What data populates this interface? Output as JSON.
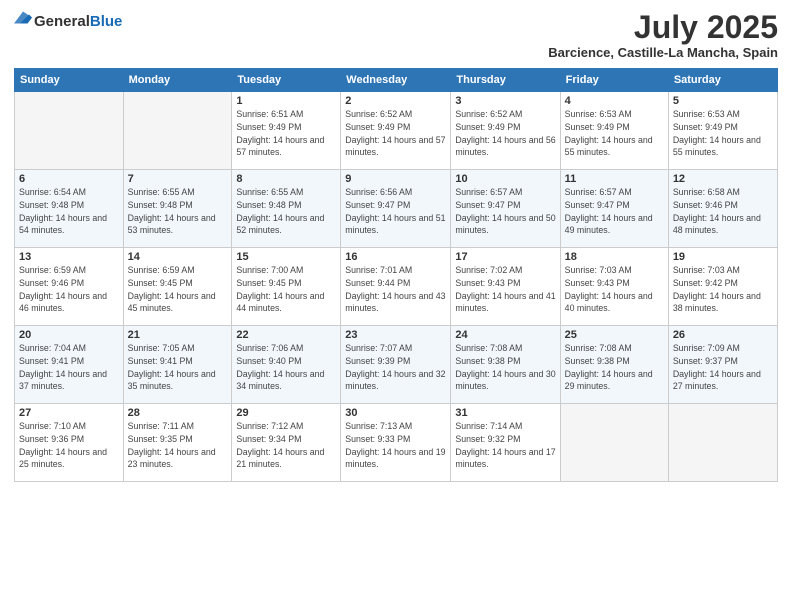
{
  "header": {
    "logo_general": "General",
    "logo_blue": "Blue",
    "title": "July 2025",
    "subtitle": "Barcience, Castille-La Mancha, Spain"
  },
  "columns": [
    "Sunday",
    "Monday",
    "Tuesday",
    "Wednesday",
    "Thursday",
    "Friday",
    "Saturday"
  ],
  "weeks": [
    [
      {
        "day": "",
        "sunrise": "",
        "sunset": "",
        "daylight": ""
      },
      {
        "day": "",
        "sunrise": "",
        "sunset": "",
        "daylight": ""
      },
      {
        "day": "1",
        "sunrise": "Sunrise: 6:51 AM",
        "sunset": "Sunset: 9:49 PM",
        "daylight": "Daylight: 14 hours and 57 minutes."
      },
      {
        "day": "2",
        "sunrise": "Sunrise: 6:52 AM",
        "sunset": "Sunset: 9:49 PM",
        "daylight": "Daylight: 14 hours and 57 minutes."
      },
      {
        "day": "3",
        "sunrise": "Sunrise: 6:52 AM",
        "sunset": "Sunset: 9:49 PM",
        "daylight": "Daylight: 14 hours and 56 minutes."
      },
      {
        "day": "4",
        "sunrise": "Sunrise: 6:53 AM",
        "sunset": "Sunset: 9:49 PM",
        "daylight": "Daylight: 14 hours and 55 minutes."
      },
      {
        "day": "5",
        "sunrise": "Sunrise: 6:53 AM",
        "sunset": "Sunset: 9:49 PM",
        "daylight": "Daylight: 14 hours and 55 minutes."
      }
    ],
    [
      {
        "day": "6",
        "sunrise": "Sunrise: 6:54 AM",
        "sunset": "Sunset: 9:48 PM",
        "daylight": "Daylight: 14 hours and 54 minutes."
      },
      {
        "day": "7",
        "sunrise": "Sunrise: 6:55 AM",
        "sunset": "Sunset: 9:48 PM",
        "daylight": "Daylight: 14 hours and 53 minutes."
      },
      {
        "day": "8",
        "sunrise": "Sunrise: 6:55 AM",
        "sunset": "Sunset: 9:48 PM",
        "daylight": "Daylight: 14 hours and 52 minutes."
      },
      {
        "day": "9",
        "sunrise": "Sunrise: 6:56 AM",
        "sunset": "Sunset: 9:47 PM",
        "daylight": "Daylight: 14 hours and 51 minutes."
      },
      {
        "day": "10",
        "sunrise": "Sunrise: 6:57 AM",
        "sunset": "Sunset: 9:47 PM",
        "daylight": "Daylight: 14 hours and 50 minutes."
      },
      {
        "day": "11",
        "sunrise": "Sunrise: 6:57 AM",
        "sunset": "Sunset: 9:47 PM",
        "daylight": "Daylight: 14 hours and 49 minutes."
      },
      {
        "day": "12",
        "sunrise": "Sunrise: 6:58 AM",
        "sunset": "Sunset: 9:46 PM",
        "daylight": "Daylight: 14 hours and 48 minutes."
      }
    ],
    [
      {
        "day": "13",
        "sunrise": "Sunrise: 6:59 AM",
        "sunset": "Sunset: 9:46 PM",
        "daylight": "Daylight: 14 hours and 46 minutes."
      },
      {
        "day": "14",
        "sunrise": "Sunrise: 6:59 AM",
        "sunset": "Sunset: 9:45 PM",
        "daylight": "Daylight: 14 hours and 45 minutes."
      },
      {
        "day": "15",
        "sunrise": "Sunrise: 7:00 AM",
        "sunset": "Sunset: 9:45 PM",
        "daylight": "Daylight: 14 hours and 44 minutes."
      },
      {
        "day": "16",
        "sunrise": "Sunrise: 7:01 AM",
        "sunset": "Sunset: 9:44 PM",
        "daylight": "Daylight: 14 hours and 43 minutes."
      },
      {
        "day": "17",
        "sunrise": "Sunrise: 7:02 AM",
        "sunset": "Sunset: 9:43 PM",
        "daylight": "Daylight: 14 hours and 41 minutes."
      },
      {
        "day": "18",
        "sunrise": "Sunrise: 7:03 AM",
        "sunset": "Sunset: 9:43 PM",
        "daylight": "Daylight: 14 hours and 40 minutes."
      },
      {
        "day": "19",
        "sunrise": "Sunrise: 7:03 AM",
        "sunset": "Sunset: 9:42 PM",
        "daylight": "Daylight: 14 hours and 38 minutes."
      }
    ],
    [
      {
        "day": "20",
        "sunrise": "Sunrise: 7:04 AM",
        "sunset": "Sunset: 9:41 PM",
        "daylight": "Daylight: 14 hours and 37 minutes."
      },
      {
        "day": "21",
        "sunrise": "Sunrise: 7:05 AM",
        "sunset": "Sunset: 9:41 PM",
        "daylight": "Daylight: 14 hours and 35 minutes."
      },
      {
        "day": "22",
        "sunrise": "Sunrise: 7:06 AM",
        "sunset": "Sunset: 9:40 PM",
        "daylight": "Daylight: 14 hours and 34 minutes."
      },
      {
        "day": "23",
        "sunrise": "Sunrise: 7:07 AM",
        "sunset": "Sunset: 9:39 PM",
        "daylight": "Daylight: 14 hours and 32 minutes."
      },
      {
        "day": "24",
        "sunrise": "Sunrise: 7:08 AM",
        "sunset": "Sunset: 9:38 PM",
        "daylight": "Daylight: 14 hours and 30 minutes."
      },
      {
        "day": "25",
        "sunrise": "Sunrise: 7:08 AM",
        "sunset": "Sunset: 9:38 PM",
        "daylight": "Daylight: 14 hours and 29 minutes."
      },
      {
        "day": "26",
        "sunrise": "Sunrise: 7:09 AM",
        "sunset": "Sunset: 9:37 PM",
        "daylight": "Daylight: 14 hours and 27 minutes."
      }
    ],
    [
      {
        "day": "27",
        "sunrise": "Sunrise: 7:10 AM",
        "sunset": "Sunset: 9:36 PM",
        "daylight": "Daylight: 14 hours and 25 minutes."
      },
      {
        "day": "28",
        "sunrise": "Sunrise: 7:11 AM",
        "sunset": "Sunset: 9:35 PM",
        "daylight": "Daylight: 14 hours and 23 minutes."
      },
      {
        "day": "29",
        "sunrise": "Sunrise: 7:12 AM",
        "sunset": "Sunset: 9:34 PM",
        "daylight": "Daylight: 14 hours and 21 minutes."
      },
      {
        "day": "30",
        "sunrise": "Sunrise: 7:13 AM",
        "sunset": "Sunset: 9:33 PM",
        "daylight": "Daylight: 14 hours and 19 minutes."
      },
      {
        "day": "31",
        "sunrise": "Sunrise: 7:14 AM",
        "sunset": "Sunset: 9:32 PM",
        "daylight": "Daylight: 14 hours and 17 minutes."
      },
      {
        "day": "",
        "sunrise": "",
        "sunset": "",
        "daylight": ""
      },
      {
        "day": "",
        "sunrise": "",
        "sunset": "",
        "daylight": ""
      }
    ]
  ]
}
